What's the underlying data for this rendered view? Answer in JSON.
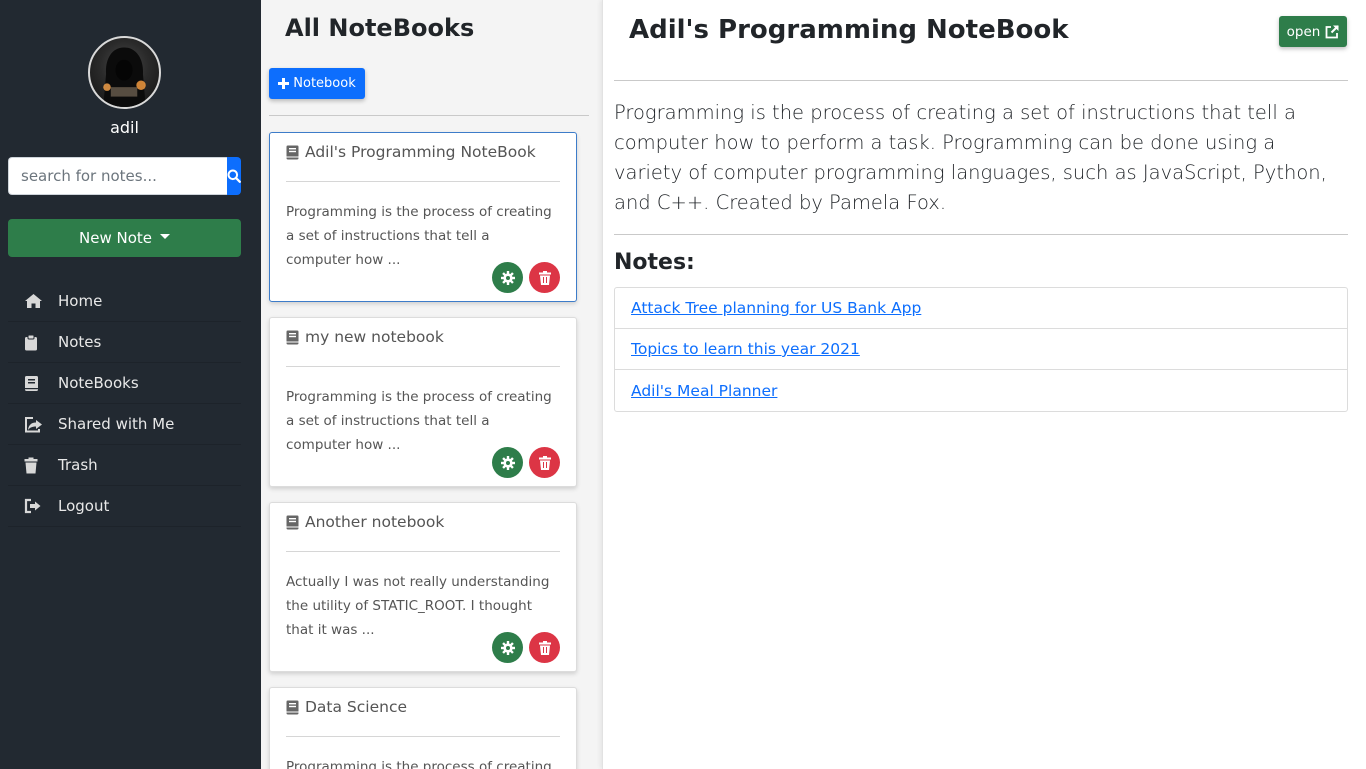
{
  "sidebar": {
    "username": "adil",
    "search": {
      "placeholder": "search for notes..."
    },
    "new_note_label": "New Note",
    "nav": [
      {
        "label": "Home",
        "icon": "home-icon"
      },
      {
        "label": "Notes",
        "icon": "clipboard-icon"
      },
      {
        "label": "NoteBooks",
        "icon": "book-icon"
      },
      {
        "label": "Shared with Me",
        "icon": "share-icon"
      },
      {
        "label": "Trash",
        "icon": "trash-icon"
      },
      {
        "label": "Logout",
        "icon": "logout-icon"
      }
    ]
  },
  "notebooks_panel": {
    "title": "All NoteBooks",
    "add_button_label": "Notebook",
    "cards": [
      {
        "title": "Adil's Programming NoteBook",
        "excerpt": "Programming is the process of creating a set of instructions that tell a computer how ..."
      },
      {
        "title": "my new notebook",
        "excerpt": "Programming is the process of creating a set of instructions that tell a computer how ..."
      },
      {
        "title": "Another notebook",
        "excerpt": "Actually I was not really understanding the utility of STATIC_ROOT. I thought that it was ..."
      },
      {
        "title": "Data Science",
        "excerpt": "Programming is the process of creating a"
      }
    ]
  },
  "detail": {
    "title": "Adil's Programming NoteBook",
    "open_label": "open",
    "description": "Programming is the process of creating a set of instructions that tell a computer how to perform a task. Programming can be done using a variety of computer programming languages, such as JavaScript, Python, and C++. Created by Pamela Fox.",
    "notes_heading": "Notes:",
    "notes": [
      "Attack Tree planning for US Bank App",
      "Topics to learn this year 2021",
      "Adil's Meal Planner"
    ]
  },
  "colors": {
    "sidebar_bg": "#222931",
    "primary": "#0d6efd",
    "success": "#2e7d4a",
    "danger": "#dc3545"
  }
}
